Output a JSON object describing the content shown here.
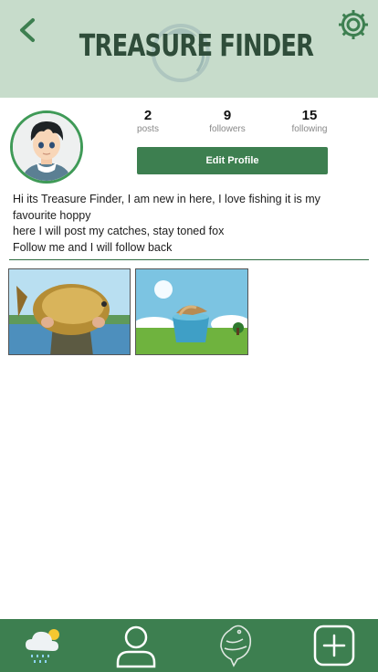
{
  "header": {
    "title": "TREASURE FINDER",
    "icons": {
      "back": "chevron-left-icon",
      "settings": "gear-icon",
      "logo": "fish-hook-logo"
    }
  },
  "profile": {
    "stats": [
      {
        "value": "2",
        "label": "posts"
      },
      {
        "value": "9",
        "label": "followers"
      },
      {
        "value": "15",
        "label": "following"
      }
    ],
    "edit_button_label": "Edit Profile",
    "bio_lines": [
      "Hi its Treasure Finder, I am new in here, I love fishing it is my",
      "favourite hoppy",
      "here I will post my catches, stay toned fox",
      "Follow me and I will follow back"
    ]
  },
  "posts": [
    {
      "name": "post-carp-catch"
    },
    {
      "name": "post-fish-bucket"
    }
  ],
  "bottom_nav": [
    {
      "icon": "weather-icon"
    },
    {
      "icon": "user-icon"
    },
    {
      "icon": "fish-icon"
    },
    {
      "icon": "add-post-icon"
    }
  ],
  "colors": {
    "header_bg": "#c7dccb",
    "accent_green": "#3d7f50",
    "title_dark": "#2f4d3a"
  }
}
